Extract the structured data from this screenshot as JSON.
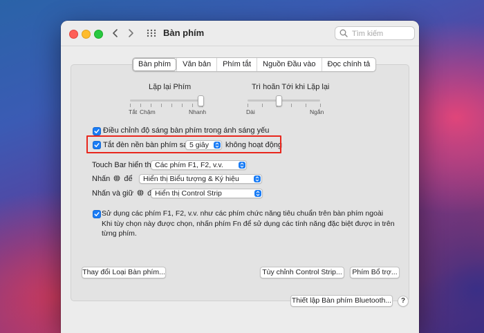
{
  "window": {
    "title": "Bàn phím",
    "search_placeholder": "Tìm kiếm"
  },
  "tabs": [
    "Bàn phím",
    "Văn bản",
    "Phím tắt",
    "Nguồn Đầu vào",
    "Đọc chính tả"
  ],
  "active_tab": "Bàn phím",
  "sliders": {
    "key_repeat": {
      "title": "Lặp lại Phím",
      "labels": [
        "Tắt",
        "Chậm",
        "Nhanh"
      ],
      "level": 1.0
    },
    "delay_until_repeat": {
      "title": "Trì hoãn Tới khi Lặp lại",
      "labels": [
        "Dài",
        "Ngắn"
      ],
      "level": 0.43
    }
  },
  "settings": {
    "adjust_brightness": {
      "checked": true,
      "label": "Điều chỉnh độ sáng bàn phím trong ánh sáng yếu"
    },
    "backlight_off": {
      "checked": true,
      "label": "Tắt đèn nền bàn phím sau",
      "value": "5 giây",
      "suffix": "không hoạt động"
    },
    "touch_bar": {
      "label": "Touch Bar hiển thị",
      "value": "Các phím F1, F2, v.v."
    },
    "press_globe": {
      "label_pre": "Nhấn",
      "label_post": "để",
      "value": "Hiển thị Biểu tượng & Ký hiệu"
    },
    "press_hold_globe": {
      "label_pre": "Nhấn và giữ",
      "label_post": "để",
      "value": "Hiển thị Control Strip"
    },
    "function_keys": {
      "checked": true,
      "line1": "Sử dụng các phím F1, F2, v.v. như các phím chức năng tiêu chuẩn trên bàn phím ngoài",
      "line2": "Khi tùy chọn này được chọn, nhấn phím Fn để sử dụng các tính năng đặc biệt được in trên",
      "line3": "từng phím."
    }
  },
  "buttons": {
    "change_keyboard_type": "Thay đổi Loại Bàn phím...",
    "customize_control_strip": "Tùy chỉnh Control Strip...",
    "modifier_keys": "Phím Bổ trợ...",
    "bluetooth_keyboard": "Thiết lập Bàn phím Bluetooth...",
    "help": "?"
  },
  "colors": {
    "accent": "#1a7cf5",
    "highlight_box": "#e8261c"
  },
  "icons": [
    "back-icon",
    "forward-icon",
    "grid-icon",
    "search-icon",
    "checkmark-icon",
    "globe-icon",
    "popup-chevron-icon"
  ]
}
